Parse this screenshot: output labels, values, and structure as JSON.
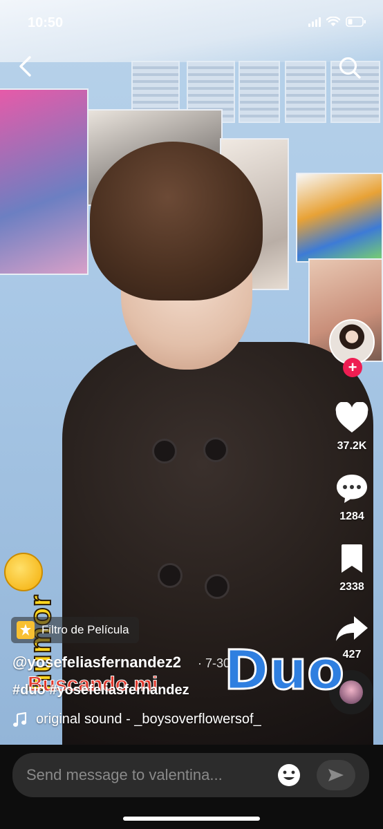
{
  "status_bar": {
    "time": "10:50"
  },
  "nav": {
    "back_icon": "chevron-left-icon",
    "search_icon": "search-icon"
  },
  "actions": {
    "like_count": "37.2K",
    "comment_count": "1284",
    "save_count": "2338",
    "share_count": "427",
    "follow_symbol": "+"
  },
  "overlay": {
    "sticker_word": "humor",
    "title_word": "Duo",
    "subtitle": "Buscando mi"
  },
  "post": {
    "effect_label": "Filtro de Película",
    "username": "@yosefeliasfernandez2",
    "date": "· 7-30",
    "hashtags": "#duo #yosefeliasfernandez",
    "sound": "original sound - _boysoverflowersof_"
  },
  "message_bar": {
    "placeholder": "Send message to valentina..."
  },
  "colors": {
    "accent_red": "#ee1d52",
    "duo_blue": "#2f7fe0",
    "sticker_yellow": "#ffd61f"
  }
}
